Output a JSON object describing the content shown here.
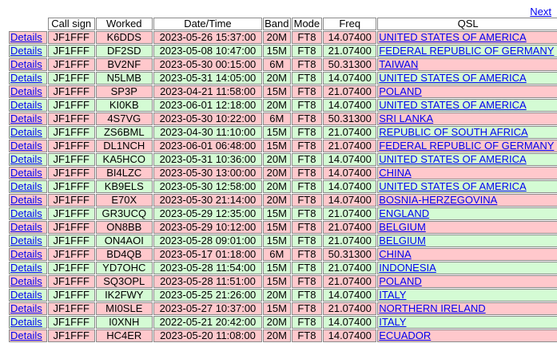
{
  "pager": {
    "next_label": "Next"
  },
  "columns": [
    "",
    "Call sign",
    "Worked",
    "Date/Time",
    "Band",
    "Mode",
    "Freq",
    "QSL"
  ],
  "details_label": "Details",
  "colors": {
    "row_even": "#ffc8cc",
    "row_odd": "#d4fbd4",
    "link": "#0000ee"
  },
  "rows": [
    {
      "call": "JF1FFF",
      "worked": "K6DDS",
      "datetime": "2023-05-26 15:37:00",
      "band": "20M",
      "mode": "FT8",
      "freq": "14.07400",
      "qsl": "UNITED STATES OF AMERICA"
    },
    {
      "call": "JF1FFF",
      "worked": "DF2SD",
      "datetime": "2023-05-08 10:47:00",
      "band": "15M",
      "mode": "FT8",
      "freq": "21.07400",
      "qsl": "FEDERAL REPUBLIC OF GERMANY"
    },
    {
      "call": "JF1FFF",
      "worked": "BV2NF",
      "datetime": "2023-05-30 00:15:00",
      "band": "6M",
      "mode": "FT8",
      "freq": "50.31300",
      "qsl": "TAIWAN"
    },
    {
      "call": "JF1FFF",
      "worked": "N5LMB",
      "datetime": "2023-05-31 14:05:00",
      "band": "20M",
      "mode": "FT8",
      "freq": "14.07400",
      "qsl": "UNITED STATES OF AMERICA"
    },
    {
      "call": "JF1FFF",
      "worked": "SP3P",
      "datetime": "2023-04-21 11:58:00",
      "band": "15M",
      "mode": "FT8",
      "freq": "21.07400",
      "qsl": "POLAND"
    },
    {
      "call": "JF1FFF",
      "worked": "KI0KB",
      "datetime": "2023-06-01 12:18:00",
      "band": "20M",
      "mode": "FT8",
      "freq": "14.07400",
      "qsl": "UNITED STATES OF AMERICA"
    },
    {
      "call": "JF1FFF",
      "worked": "4S7VG",
      "datetime": "2023-05-30 10:22:00",
      "band": "6M",
      "mode": "FT8",
      "freq": "50.31300",
      "qsl": "SRI LANKA"
    },
    {
      "call": "JF1FFF",
      "worked": "ZS6BML",
      "datetime": "2023-04-30 11:10:00",
      "band": "15M",
      "mode": "FT8",
      "freq": "21.07400",
      "qsl": "REPUBLIC OF SOUTH AFRICA"
    },
    {
      "call": "JF1FFF",
      "worked": "DL1NCH",
      "datetime": "2023-06-01 06:48:00",
      "band": "15M",
      "mode": "FT8",
      "freq": "21.07400",
      "qsl": "FEDERAL REPUBLIC OF GERMANY"
    },
    {
      "call": "JF1FFF",
      "worked": "KA5HCO",
      "datetime": "2023-05-31 10:36:00",
      "band": "20M",
      "mode": "FT8",
      "freq": "14.07400",
      "qsl": "UNITED STATES OF AMERICA"
    },
    {
      "call": "JF1FFF",
      "worked": "BI4LZC",
      "datetime": "2023-05-30 13:00:00",
      "band": "20M",
      "mode": "FT8",
      "freq": "14.07400",
      "qsl": "CHINA"
    },
    {
      "call": "JF1FFF",
      "worked": "KB9ELS",
      "datetime": "2023-05-30 12:58:00",
      "band": "20M",
      "mode": "FT8",
      "freq": "14.07400",
      "qsl": "UNITED STATES OF AMERICA"
    },
    {
      "call": "JF1FFF",
      "worked": "E70X",
      "datetime": "2023-05-30 21:14:00",
      "band": "20M",
      "mode": "FT8",
      "freq": "14.07400",
      "qsl": "BOSNIA-HERZEGOVINA"
    },
    {
      "call": "JF1FFF",
      "worked": "GR3UCQ",
      "datetime": "2023-05-29 12:35:00",
      "band": "15M",
      "mode": "FT8",
      "freq": "21.07400",
      "qsl": "ENGLAND"
    },
    {
      "call": "JF1FFF",
      "worked": "ON8BB",
      "datetime": "2023-05-29 10:12:00",
      "band": "15M",
      "mode": "FT8",
      "freq": "21.07400",
      "qsl": "BELGIUM"
    },
    {
      "call": "JF1FFF",
      "worked": "ON4AOI",
      "datetime": "2023-05-28 09:01:00",
      "band": "15M",
      "mode": "FT8",
      "freq": "21.07400",
      "qsl": "BELGIUM"
    },
    {
      "call": "JF1FFF",
      "worked": "BD4QB",
      "datetime": "2023-05-17 01:18:00",
      "band": "6M",
      "mode": "FT8",
      "freq": "50.31300",
      "qsl": "CHINA"
    },
    {
      "call": "JF1FFF",
      "worked": "YD7OHC",
      "datetime": "2023-05-28 11:54:00",
      "band": "15M",
      "mode": "FT8",
      "freq": "21.07400",
      "qsl": "INDONESIA"
    },
    {
      "call": "JF1FFF",
      "worked": "SQ3OPL",
      "datetime": "2023-05-28 11:51:00",
      "band": "15M",
      "mode": "FT8",
      "freq": "21.07400",
      "qsl": "POLAND"
    },
    {
      "call": "JF1FFF",
      "worked": "IK2FWY",
      "datetime": "2023-05-25 21:26:00",
      "band": "20M",
      "mode": "FT8",
      "freq": "14.07400",
      "qsl": "ITALY"
    },
    {
      "call": "JF1FFF",
      "worked": "MI0SLE",
      "datetime": "2023-05-27 10:37:00",
      "band": "15M",
      "mode": "FT8",
      "freq": "21.07400",
      "qsl": "NORTHERN IRELAND"
    },
    {
      "call": "JF1FFF",
      "worked": "I0XNH",
      "datetime": "2022-05-21 20:42:00",
      "band": "20M",
      "mode": "FT8",
      "freq": "14.07400",
      "qsl": "ITALY"
    },
    {
      "call": "JF1FFF",
      "worked": "HC4ER",
      "datetime": "2023-05-20 11:08:00",
      "band": "20M",
      "mode": "FT8",
      "freq": "14.07400",
      "qsl": "ECUADOR"
    }
  ]
}
